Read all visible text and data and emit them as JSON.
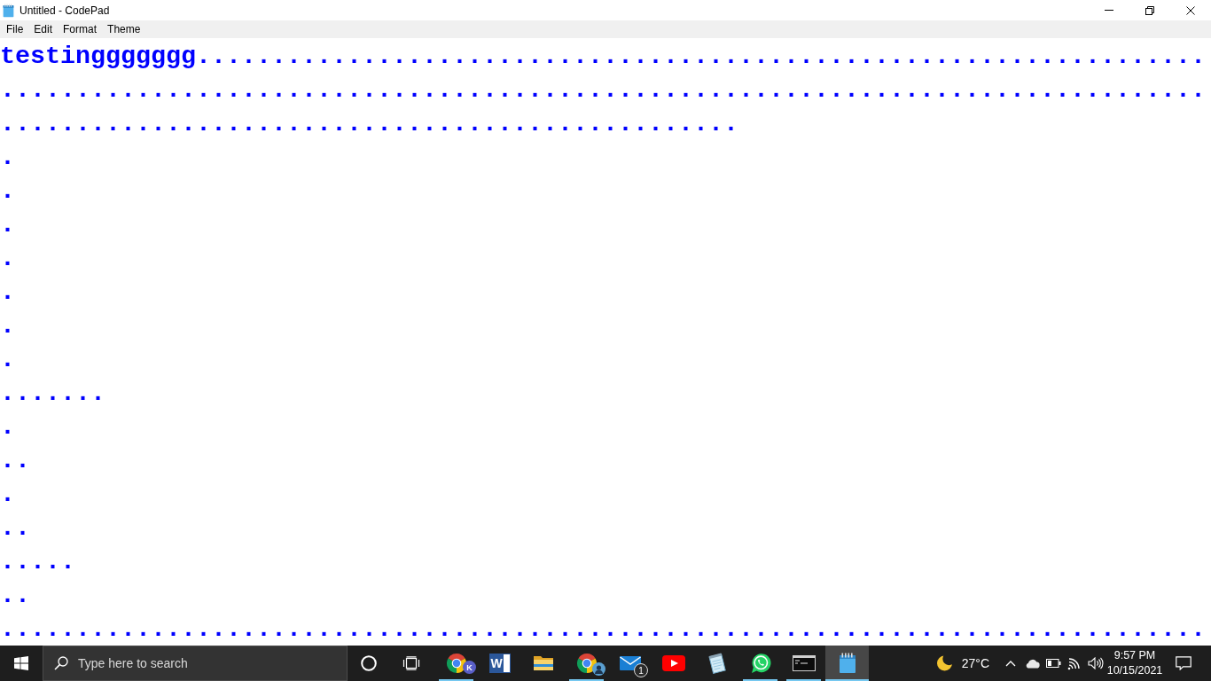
{
  "window": {
    "title": "Untitled - CodePad"
  },
  "menu": [
    {
      "label": "File"
    },
    {
      "label": "Edit"
    },
    {
      "label": "Format"
    },
    {
      "label": "Theme"
    }
  ],
  "editor": {
    "lines": [
      "testinggggggg...................................................................",
      "................................................................................",
      ".................................................",
      ".",
      ".",
      ".",
      ".",
      ".",
      ".",
      ".",
      ".......",
      ".",
      "..",
      ".",
      "..",
      ".....",
      "..",
      "................................................................................"
    ]
  },
  "taskbar": {
    "search": {
      "placeholder": "Type here to search"
    },
    "apps": [
      {
        "kind": "browser",
        "badge": "K",
        "running": true,
        "selected": false
      },
      {
        "kind": "document",
        "letter": "W",
        "running": false,
        "selected": false
      },
      {
        "kind": "folder",
        "running": false,
        "selected": false
      },
      {
        "kind": "browser",
        "profile_photo": true,
        "running": true,
        "selected": false
      },
      {
        "kind": "mail",
        "badge": "1",
        "running": false,
        "selected": false
      },
      {
        "kind": "video",
        "running": false,
        "selected": false
      },
      {
        "kind": "notes",
        "running": false,
        "selected": false
      },
      {
        "kind": "chat",
        "running": true,
        "selected": false
      },
      {
        "kind": "terminal",
        "running": true,
        "selected": false
      },
      {
        "kind": "notepad",
        "running": true,
        "selected": true
      }
    ],
    "weather": {
      "temperature": "27°C"
    },
    "clock": {
      "time": "9:57 PM",
      "date": "10/15/2021"
    }
  }
}
